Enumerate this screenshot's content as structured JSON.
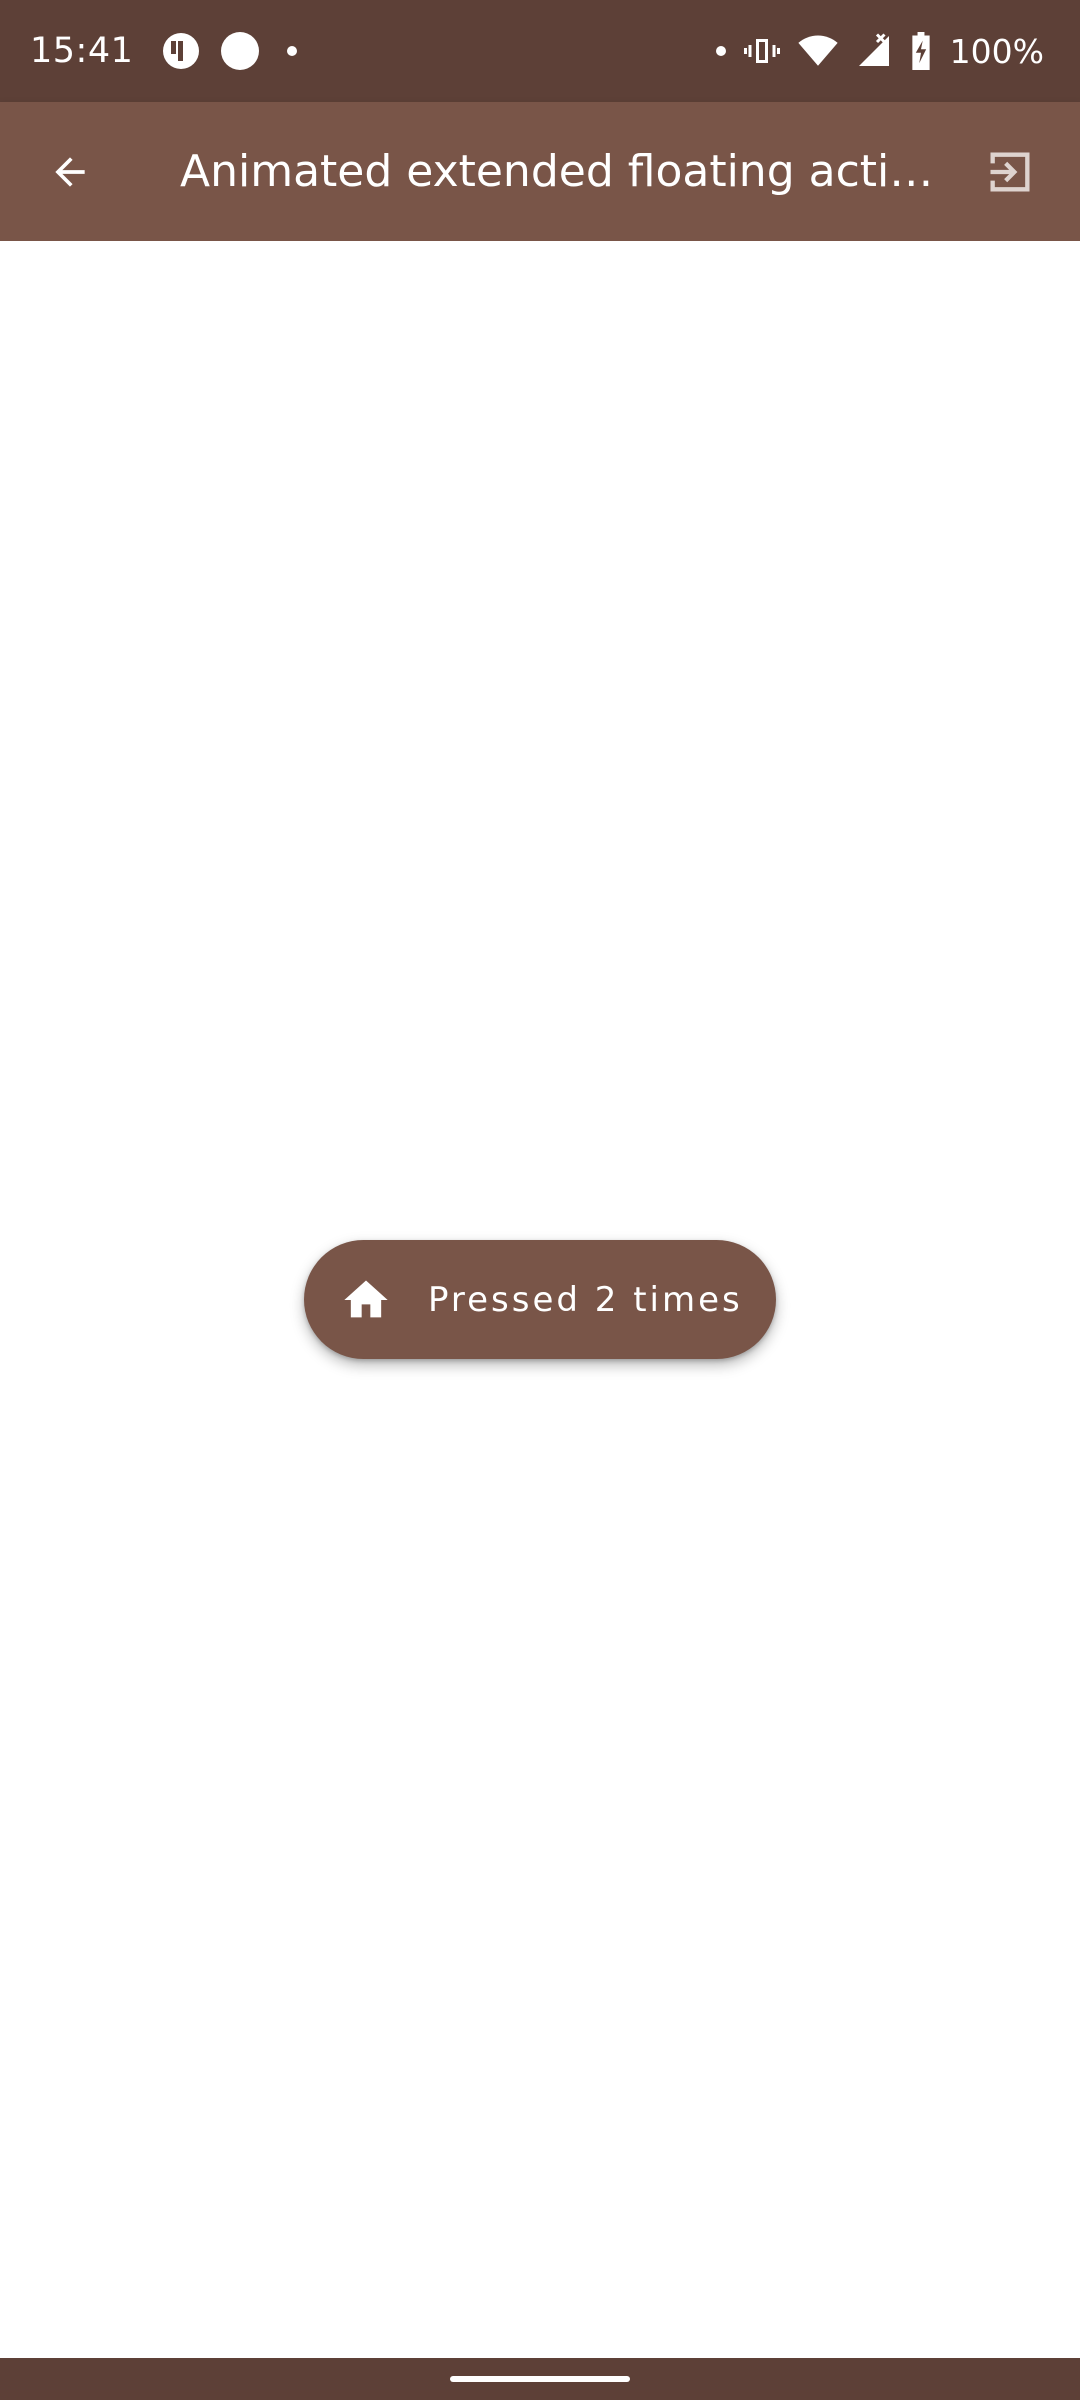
{
  "status_bar": {
    "time": "15:41",
    "battery": "100%",
    "icons": [
      "app-notification-icon",
      "circle-notification-icon",
      "dot-icon",
      "dot-icon",
      "vibrate-icon",
      "wifi-icon",
      "signal-icon",
      "battery-charging-icon"
    ]
  },
  "app_bar": {
    "title": "Animated extended floating action …",
    "back_icon": "arrow-back-icon",
    "exit_icon": "exit-to-app-icon"
  },
  "fab": {
    "label": "Pressed 2 times",
    "icon": "home-icon"
  },
  "colors": {
    "status_bar": "#5d4037",
    "primary": "#795548",
    "background": "#ffffff",
    "on_primary": "#ffffff"
  }
}
